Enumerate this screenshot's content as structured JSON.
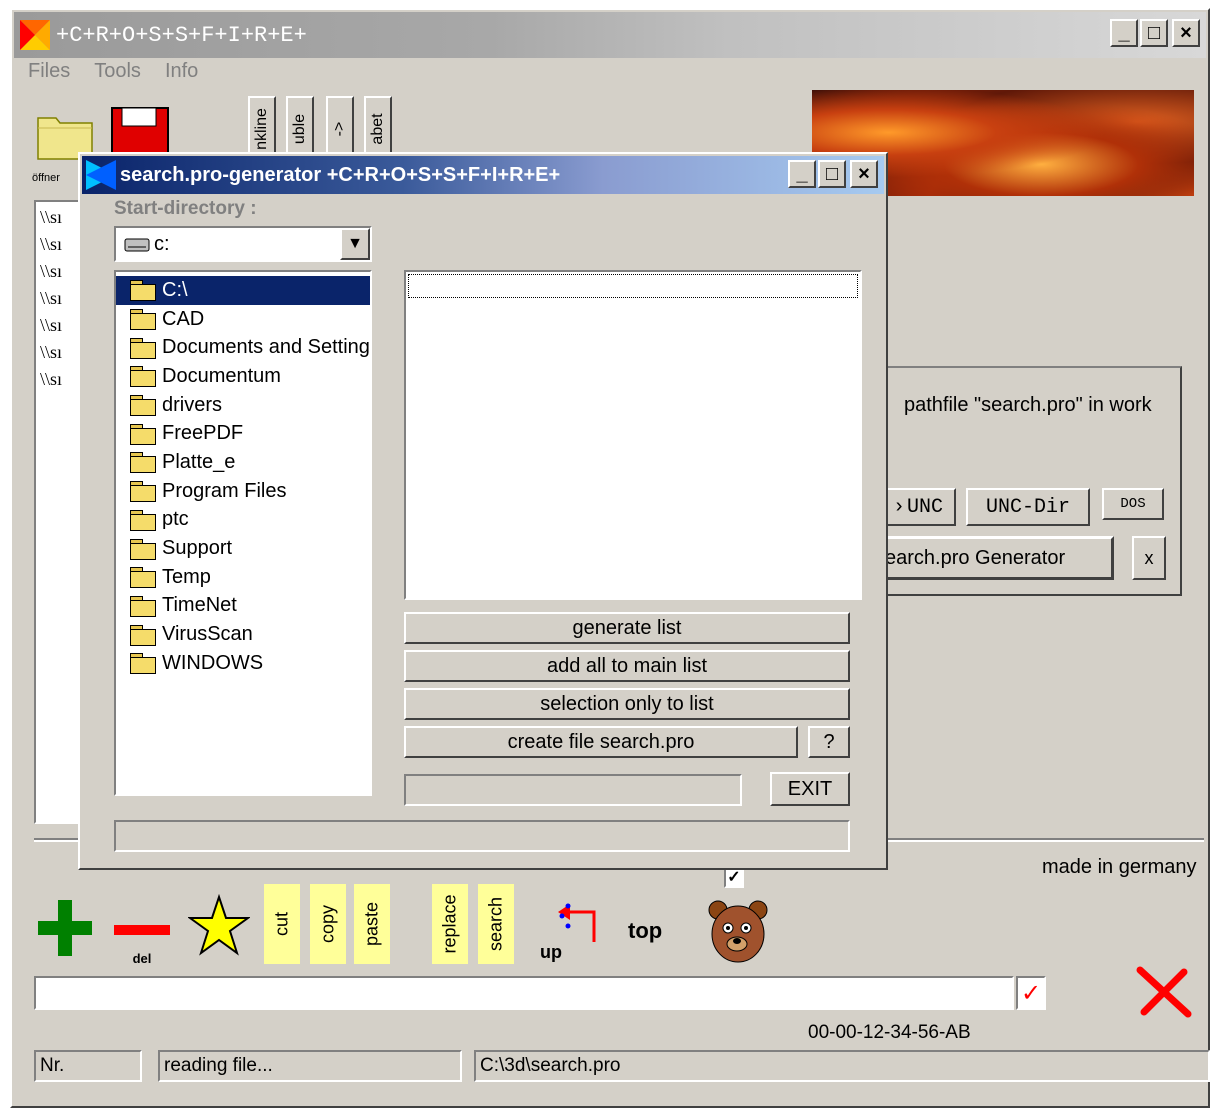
{
  "window": {
    "title": "+C+R+O+S+S+F+I+R+E+",
    "min": "_",
    "max": "□",
    "close": "×"
  },
  "menu": [
    "Files",
    "Tools",
    "Info"
  ],
  "toolbar": {
    "open_label": "öffner",
    "tabs": [
      "nkline",
      "uble",
      "->",
      "abet"
    ]
  },
  "main_list": [
    "\\\\sı",
    "\\\\sı",
    "\\\\sı",
    "\\\\sı",
    "\\\\sı",
    "\\\\sı",
    "\\\\sı"
  ],
  "right_panel": {
    "status": "pathfile \"search.pro\" in work",
    "btn_unc": "UNC",
    "btn_unc_dir": "UNC-Dir",
    "btn_dos": "DOS",
    "btn_generator": "earch.pro Generator",
    "btn_x": "x"
  },
  "made_in": "made in germany",
  "bottom_toolbar": {
    "del": "del",
    "cut": "cut",
    "copy": "copy",
    "paste": "paste",
    "replace": "replace",
    "search": "search",
    "up": "up",
    "top": "top"
  },
  "command_input": {
    "value": ""
  },
  "mac_address": "00-00-12-34-56-AB",
  "statusbar": {
    "nr": "Nr.",
    "message": "reading file...",
    "path": "C:\\3d\\search.pro"
  },
  "dialog": {
    "title": "search.pro-generator  +C+R+O+S+S+F+I+R+E+",
    "start_dir_label": "Start-directory :",
    "drive": "c:",
    "folders": [
      "C:\\",
      "CAD",
      "Documents and Settings",
      "Documentum",
      "drivers",
      "FreePDF",
      "Platte_e",
      "Program Files",
      "ptc",
      "Support",
      "Temp",
      "TimeNet",
      "VirusScan",
      "WINDOWS"
    ],
    "btn_generate": "generate list",
    "btn_add_all": "add all to main list",
    "btn_selection": "selection only to list",
    "btn_create": "create file search.pro",
    "btn_help": "?",
    "btn_exit": "EXIT"
  },
  "colors": {
    "title_active": "#0a246a",
    "face": "#d4d0c8",
    "yellow_btn": "#ffff99",
    "plus": "#008000",
    "del": "#ff0000"
  }
}
